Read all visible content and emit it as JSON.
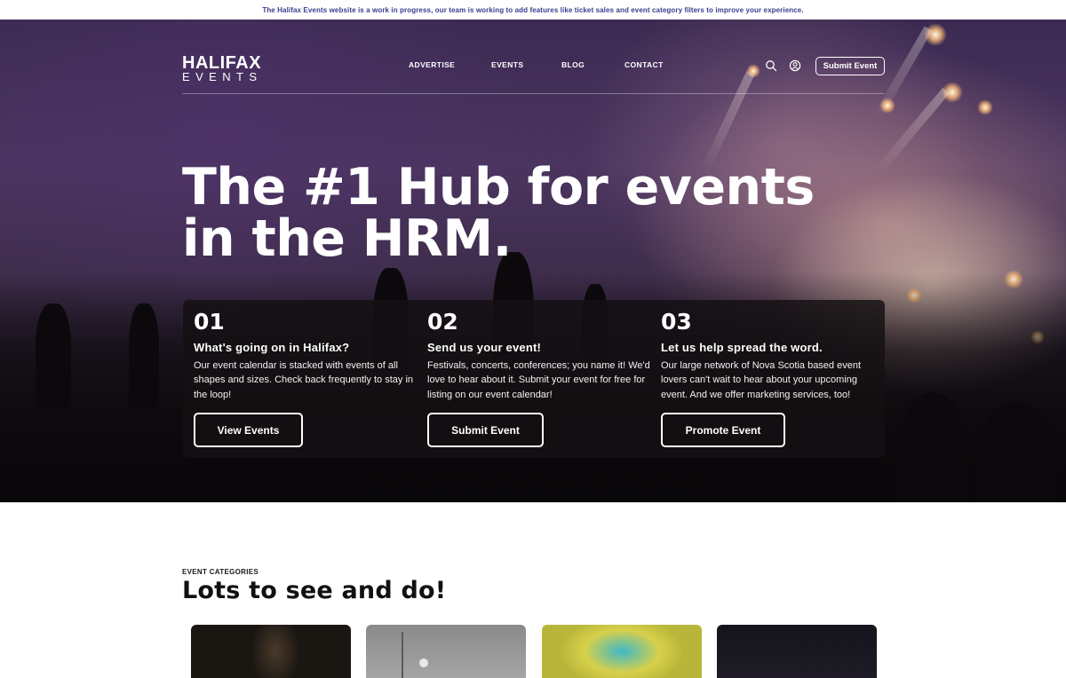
{
  "announcement": "The Halifax Events website is a work in progress, our team is working to add features like ticket sales and event category filters to improve your experience.",
  "logo": {
    "top": "HALIFAX",
    "bottom": "EVENTS"
  },
  "nav": {
    "links": [
      "ADVERTISE",
      "EVENTS",
      "BLOG",
      "CONTACT"
    ],
    "submit_label": "Submit Event",
    "search_icon": "search-icon",
    "account_icon": "user-icon"
  },
  "hero": {
    "headline": "The #1 Hub for events in the HRM."
  },
  "cards": [
    {
      "number": "01",
      "title": "What's going on in Halifax?",
      "body": "Our event calendar is stacked with events of all shapes and sizes. Check back frequently to stay in the loop!",
      "button": "View Events"
    },
    {
      "number": "02",
      "title": "Send us your event!",
      "body": "Festivals, concerts, conferences; you name it! We'd love to hear about it. Submit your event for free for listing on our event calendar!",
      "button": "Submit Event"
    },
    {
      "number": "03",
      "title": "Let us help spread the word.",
      "body": "Our large network of Nova Scotia based event lovers can't wait to hear about your upcoming event. And we offer marketing services, too!",
      "button": "Promote Event"
    }
  ],
  "categories": {
    "eyebrow": "EVENT CATEGORIES",
    "title": "Lots to see and do!"
  },
  "colors": {
    "announcement_text": "#3b3d8f",
    "card_overlay": "#141012",
    "accent": "#ffffff"
  }
}
